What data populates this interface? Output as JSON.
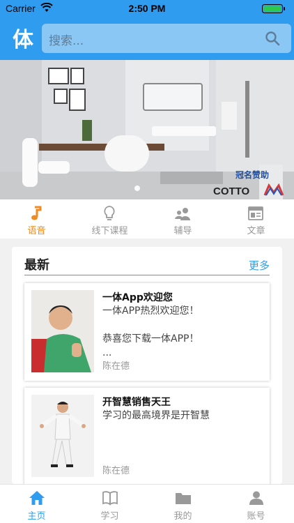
{
  "status": {
    "carrier": "Carrier",
    "time": "2:50 PM"
  },
  "header": {
    "logo": "体",
    "search_placeholder": "搜索..."
  },
  "banner": {
    "sponsor": "冠名赞助",
    "brand": "COTTO"
  },
  "categories": [
    {
      "label": "语音",
      "icon": "music-note-icon",
      "active": true
    },
    {
      "label": "线下课程",
      "icon": "lightbulb-icon",
      "active": false
    },
    {
      "label": "辅导",
      "icon": "people-icon",
      "active": false
    },
    {
      "label": "文章",
      "icon": "article-icon",
      "active": false
    }
  ],
  "latest": {
    "title": "最新",
    "more": "更多",
    "items": [
      {
        "title": "一体App欢迎您",
        "desc": "一体APP热烈欢迎您！\n\n恭喜您下载一体APP！\n...",
        "author": "陈在德"
      },
      {
        "title": "开智慧销售天王",
        "desc": "学习的最高境界是开智慧",
        "author": "陈在德"
      }
    ]
  },
  "tabs": [
    {
      "label": "主页",
      "icon": "home-icon",
      "active": true
    },
    {
      "label": "学习",
      "icon": "book-icon",
      "active": false
    },
    {
      "label": "我的",
      "icon": "folder-icon",
      "active": false
    },
    {
      "label": "账号",
      "icon": "user-icon",
      "active": false
    }
  ],
  "colors": {
    "primary": "#2f9cf0",
    "accent": "#f08a24",
    "inactive": "#999999"
  }
}
